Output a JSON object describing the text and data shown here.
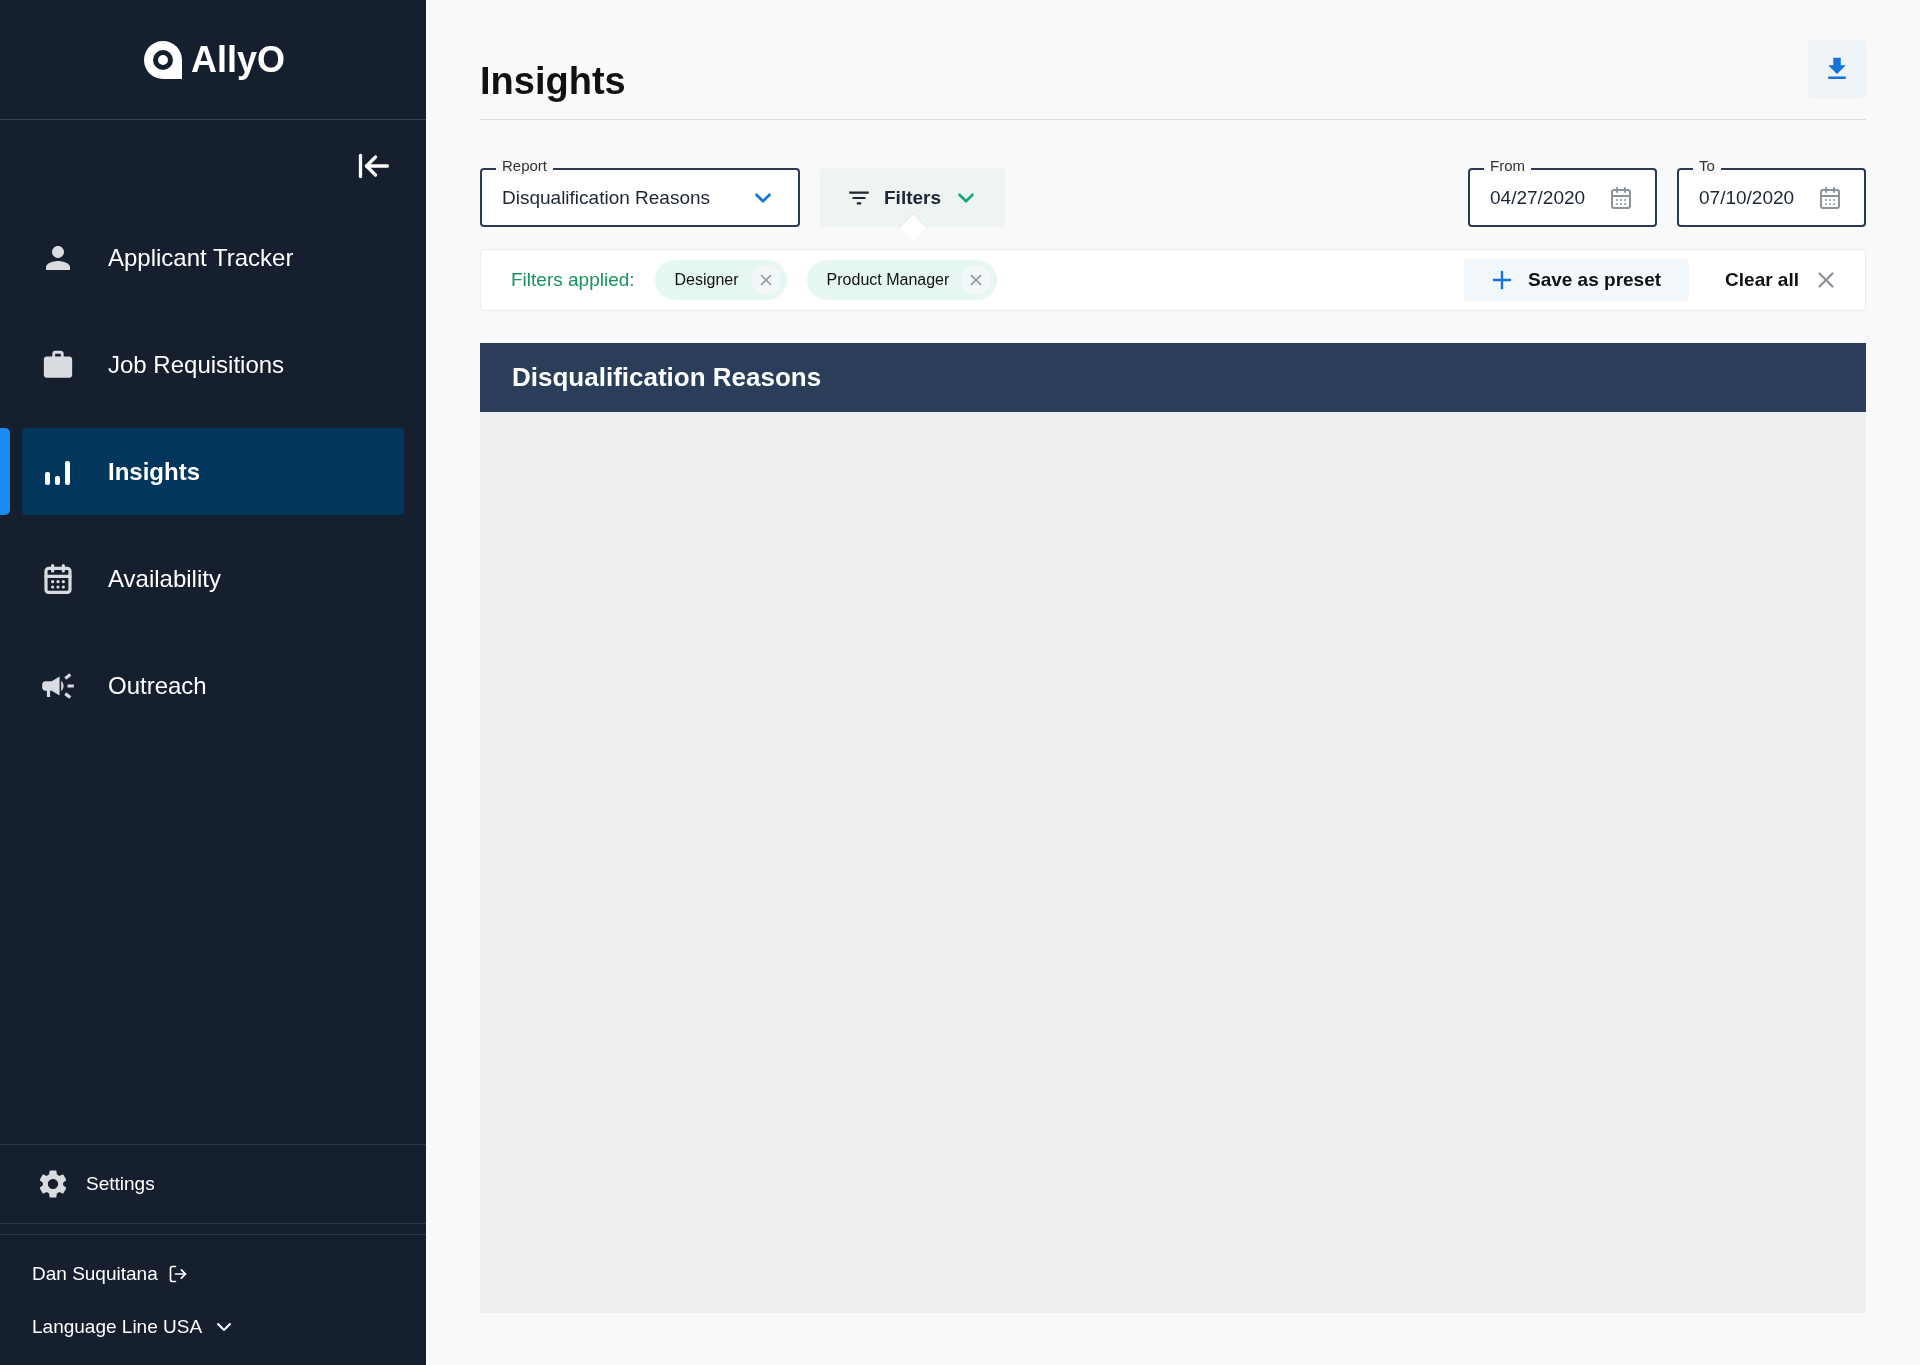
{
  "sidebar": {
    "logo": "AllyO",
    "nav": [
      {
        "label": "Applicant Tracker",
        "kind": "person",
        "selected": false
      },
      {
        "label": "Job Requisitions",
        "kind": "briefcase",
        "selected": false
      },
      {
        "label": "Insights",
        "kind": "bars",
        "selected": true
      },
      {
        "label": "Availability",
        "kind": "calendar",
        "selected": false
      },
      {
        "label": "Outreach",
        "kind": "megaphone",
        "selected": false
      }
    ],
    "settings": "Settings",
    "user": "Dan Suquitana",
    "organization": "Language Line USA"
  },
  "page": {
    "title": "Insights",
    "report": {
      "label": "Report",
      "value": "Disqualification Reasons"
    },
    "filters_button": "Filters",
    "from": {
      "label": "From",
      "value": "04/27/2020"
    },
    "to": {
      "label": "To",
      "value": "07/10/2020"
    },
    "filters_applied": {
      "label": "Filters applied:",
      "chips": [
        "Designer",
        "Product Manager"
      ],
      "save_preset": "Save as preset",
      "clear_all": "Clear all"
    },
    "panel": {
      "title": "Disqualification Reasons"
    }
  }
}
